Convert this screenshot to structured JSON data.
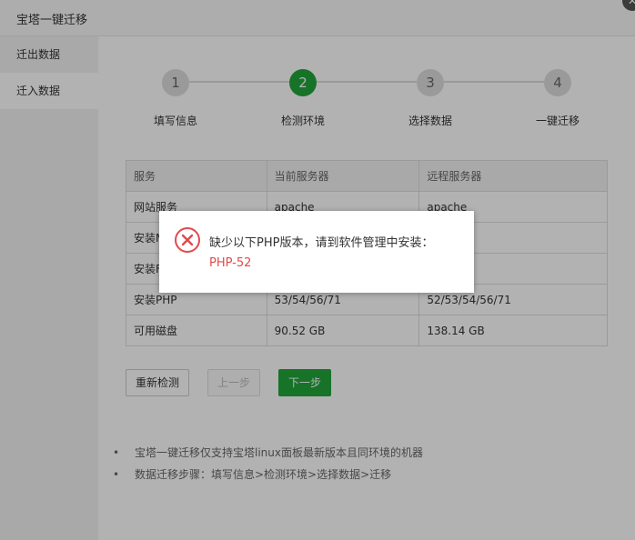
{
  "window": {
    "title": "宝塔一键迁移"
  },
  "sidebar": {
    "items": [
      {
        "label": "迁出数据"
      },
      {
        "label": "迁入数据"
      }
    ]
  },
  "steps": [
    {
      "number": "1",
      "label": "填写信息",
      "state": "pending"
    },
    {
      "number": "2",
      "label": "检测环境",
      "state": "active"
    },
    {
      "number": "3",
      "label": "选择数据",
      "state": "pending"
    },
    {
      "number": "4",
      "label": "一键迁移",
      "state": "pending"
    }
  ],
  "env_table": {
    "headers": [
      "服务",
      "当前服务器",
      "远程服务器"
    ],
    "rows": [
      [
        "网站服务",
        "apache",
        "apache"
      ],
      [
        "安装MySQL",
        "",
        ""
      ],
      [
        "安装FTP",
        "",
        ""
      ],
      [
        "安装PHP",
        "53/54/56/71",
        "52/53/54/56/71"
      ],
      [
        "可用磁盘",
        "90.52 GB",
        "138.14 GB"
      ]
    ]
  },
  "buttons": {
    "recheck": "重新检测",
    "prev": "上一步",
    "next": "下一步"
  },
  "notes": [
    "宝塔一键迁移仅支持宝塔linux面板最新版本且同环境的机器",
    "数据迁移步骤：填写信息>检测环境>选择数据>迁移"
  ],
  "alert": {
    "message": "缺少以下PHP版本，请到软件管理中安装：",
    "detail": "PHP-52",
    "icon": "error-circle-icon"
  },
  "colors": {
    "accent": "#20a53a",
    "error": "#e04b4b"
  }
}
